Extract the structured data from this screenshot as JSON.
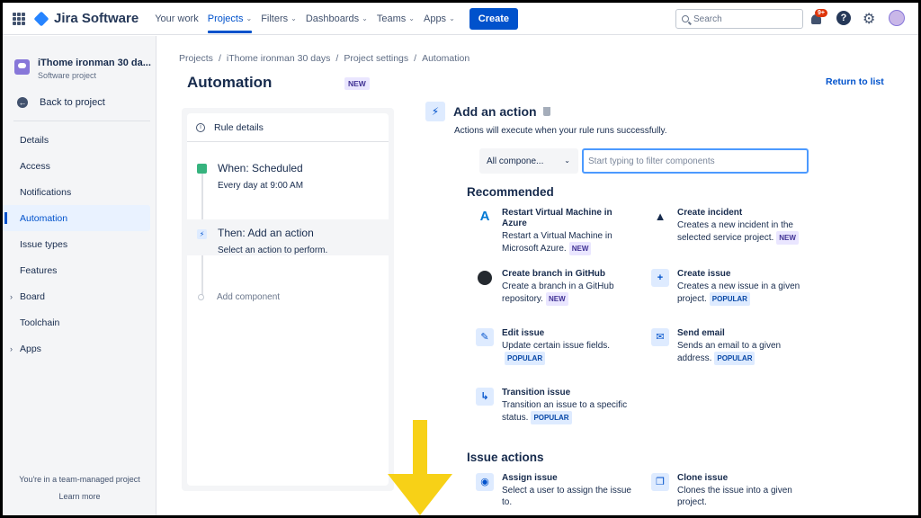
{
  "nav": {
    "product": "Jira Software",
    "items": [
      {
        "label": "Your work",
        "active": false
      },
      {
        "label": "Projects",
        "active": true
      },
      {
        "label": "Filters",
        "active": false
      },
      {
        "label": "Dashboards",
        "active": false
      },
      {
        "label": "Teams",
        "active": false
      },
      {
        "label": "Apps",
        "active": false
      }
    ],
    "create": "Create",
    "search_placeholder": "Search",
    "notif_badge": "9+",
    "help": "?",
    "accent": "#0052CC"
  },
  "sidebar": {
    "project_name": "iThome ironman 30 da...",
    "project_type": "Software project",
    "back": "Back to project",
    "items": [
      {
        "label": "Details",
        "caret": ""
      },
      {
        "label": "Access",
        "caret": ""
      },
      {
        "label": "Notifications",
        "caret": ""
      },
      {
        "label": "Automation",
        "caret": "",
        "active": true
      },
      {
        "label": "Issue types",
        "caret": ""
      },
      {
        "label": "Features",
        "caret": ""
      },
      {
        "label": "Board",
        "caret": "›"
      },
      {
        "label": "Toolchain",
        "caret": ""
      },
      {
        "label": "Apps",
        "caret": "›"
      }
    ],
    "footer": "You're in a team-managed project",
    "learn_more": "Learn more"
  },
  "breadcrumb": [
    "Projects",
    "iThome ironman 30 days",
    "Project settings",
    "Automation"
  ],
  "page": {
    "title": "Automation",
    "new_lozenge": "NEW",
    "return": "Return to list"
  },
  "rule": {
    "details": "Rule details",
    "when_title": "When: Scheduled",
    "when_sub": "Every day at 9:00 AM",
    "then_title": "Then: Add an action",
    "then_sub": "Select an action to perform.",
    "add_component": "Add component"
  },
  "action": {
    "title": "Add an action",
    "subtitle": "Actions will execute when your rule runs successfully.",
    "filter_select": "All compone...",
    "filter_placeholder": "Start typing to filter components",
    "recommended_title": "Recommended",
    "recommended": [
      {
        "icon": "azure-icon",
        "glyph": "A",
        "title": "Restart Virtual Machine in Azure",
        "desc": "Restart a Virtual Machine in Microsoft Azure.",
        "lozenge": "NEW"
      },
      {
        "icon": "warning-icon",
        "glyph": "▲",
        "title": "Create incident",
        "desc": "Creates a new incident in the selected service project.",
        "lozenge": "NEW"
      },
      {
        "icon": "github-icon",
        "glyph": "",
        "title": "Create branch in GitHub",
        "desc": "Create a branch in a GitHub repository.",
        "lozenge": "NEW"
      },
      {
        "icon": "plus-icon",
        "glyph": "+",
        "title": "Create issue",
        "desc": "Creates a new issue in a given project.",
        "lozenge": "POPULAR"
      },
      {
        "icon": "pencil-icon",
        "glyph": "✎",
        "title": "Edit issue",
        "desc": "Update certain issue fields.",
        "lozenge": "POPULAR"
      },
      {
        "icon": "mail-icon",
        "glyph": "✉",
        "title": "Send email",
        "desc": "Sends an email to a given address.",
        "lozenge": "POPULAR"
      },
      {
        "icon": "transition-icon",
        "glyph": "↳",
        "title": "Transition issue",
        "desc": "Transition an issue to a specific status.",
        "lozenge": "POPULAR"
      }
    ],
    "issue_actions_title": "Issue actions",
    "issue_actions": [
      {
        "icon": "user-icon",
        "glyph": "◉",
        "title": "Assign issue",
        "desc": "Select a user to assign the issue to."
      },
      {
        "icon": "copy-icon",
        "glyph": "❐",
        "title": "Clone issue",
        "desc": "Clones the issue into a given project."
      }
    ]
  },
  "annotation": {
    "color": "#F7D117",
    "icon": "down-arrow-icon"
  }
}
